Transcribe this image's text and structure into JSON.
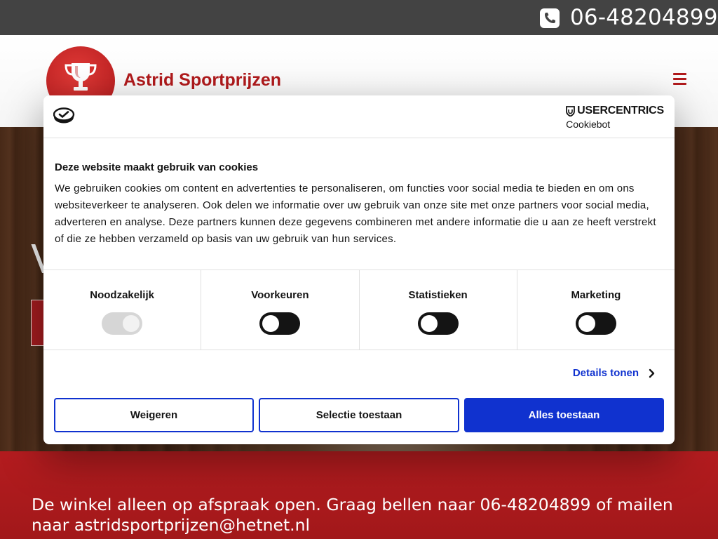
{
  "topbar": {
    "phone": "06-48204899",
    "icon": "phone-icon"
  },
  "header": {
    "brand": "Astrid Sportprijzen",
    "logo_icon": "trophy-icon",
    "menu_icon": "hamburger-icon"
  },
  "hero": {
    "partial_text": "V"
  },
  "band": {
    "text": "De winkel alleen op afspraak open. Graag bellen naar 06-48204899 of mailen naar astridsportprijzen@hetnet.nl"
  },
  "cookie": {
    "provider_name": "USERCENTRICS",
    "provider_sub": "Cookiebot",
    "title": "Deze website maakt gebruik van cookies",
    "body": "We gebruiken cookies om content en advertenties te personaliseren, om functies voor social media te bieden en om ons websiteverkeer te analyseren. Ook delen we informatie over uw gebruik van onze site met onze partners voor social media, adverteren en analyse. Deze partners kunnen deze gegevens combineren met andere informatie die u aan ze heeft verstrekt of die ze hebben verzameld op basis van uw gebruik van hun services.",
    "categories": [
      {
        "label": "Noodzakelijk",
        "enabled": true,
        "disabled": true
      },
      {
        "label": "Voorkeuren",
        "enabled": false,
        "disabled": false
      },
      {
        "label": "Statistieken",
        "enabled": false,
        "disabled": false
      },
      {
        "label": "Marketing",
        "enabled": false,
        "disabled": false
      }
    ],
    "details_label": "Details tonen",
    "buttons": {
      "decline": "Weigeren",
      "selection": "Selectie toestaan",
      "allow_all": "Alles toestaan"
    }
  },
  "colors": {
    "brand_red": "#b11a1c",
    "topbar": "#434343",
    "accent_blue": "#1032cf"
  }
}
